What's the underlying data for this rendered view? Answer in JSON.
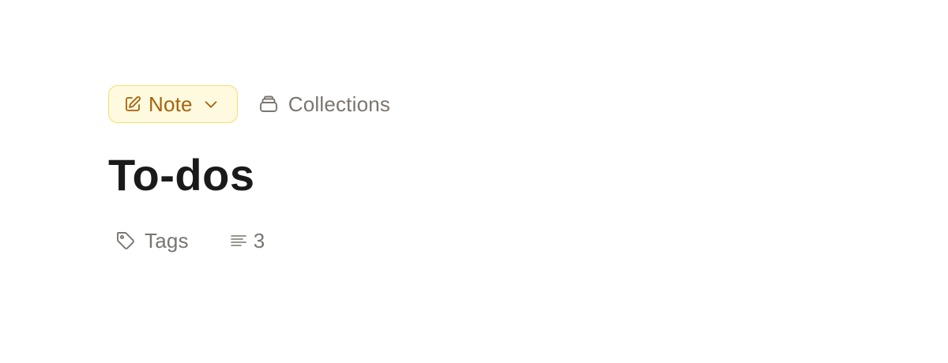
{
  "header": {
    "type_selector": {
      "label": "Note",
      "icon": "edit-note-icon",
      "dropdown_icon": "chevron-down-icon"
    },
    "collections": {
      "label": "Collections",
      "icon": "collection-icon"
    }
  },
  "document": {
    "title": "To-dos"
  },
  "meta": {
    "tags_label": "Tags",
    "tags_icon": "tag-icon",
    "block_count": "3",
    "block_count_icon": "lines-icon"
  },
  "colors": {
    "pill_background": "#fefae0",
    "pill_border": "#f3df6a",
    "pill_text": "#a8620a",
    "muted_text": "#7a756f",
    "title_text": "#1a1a1a"
  }
}
